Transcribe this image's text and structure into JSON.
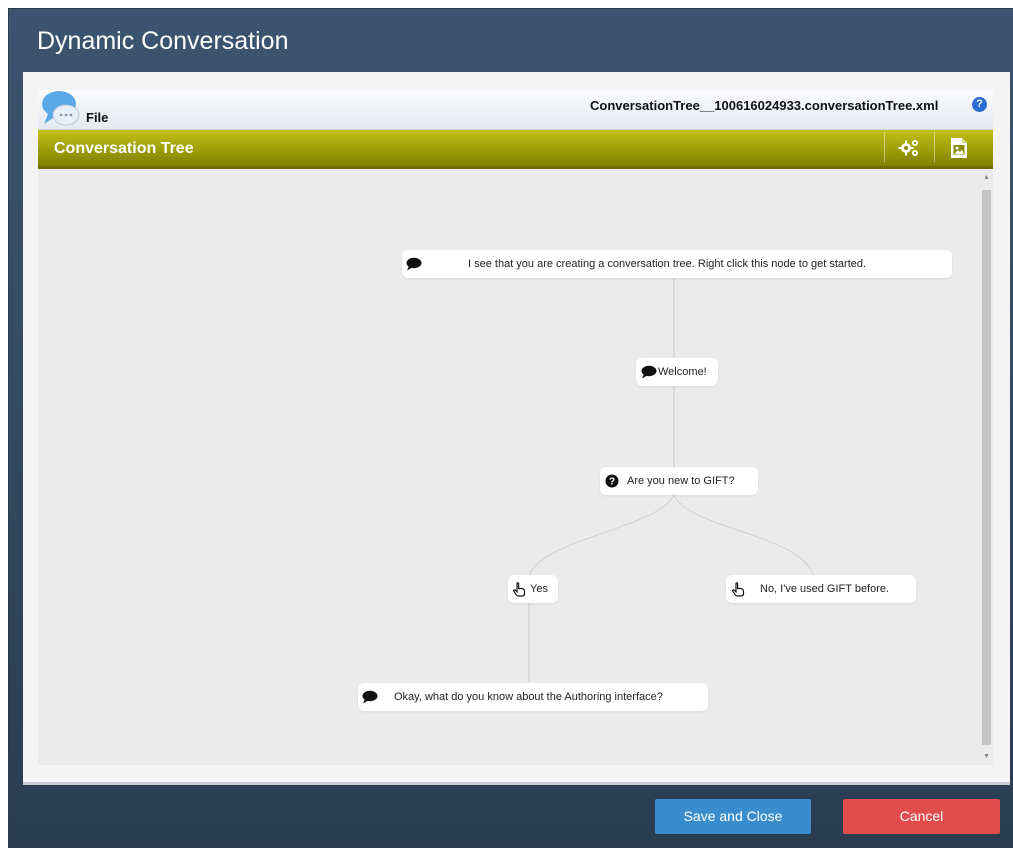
{
  "dialog": {
    "title": "Dynamic Conversation"
  },
  "file_bar": {
    "menu_label": "File",
    "filename": "ConversationTree__100616024933.conversationTree.xml",
    "help_icon": "question-circle-icon"
  },
  "tree_panel": {
    "title": "Conversation Tree",
    "buttons": [
      {
        "icon": "gears-icon"
      },
      {
        "icon": "image-file-icon"
      }
    ]
  },
  "nodes": {
    "intro": {
      "type": "message",
      "icon": "speech-bubble-icon",
      "text": "I see that you are creating a conversation tree. Right click this node to get started."
    },
    "welcome": {
      "type": "message",
      "icon": "speech-bubble-icon",
      "text": "Welcome!"
    },
    "question": {
      "type": "question",
      "icon": "question-circle-icon",
      "text": "Are you new to GIFT?"
    },
    "choice_yes": {
      "type": "choice",
      "icon": "pointing-hand-icon",
      "text": "Yes"
    },
    "choice_no": {
      "type": "choice",
      "icon": "pointing-hand-icon",
      "text": "No, I've used GIFT before."
    },
    "followup": {
      "type": "message",
      "icon": "speech-bubble-icon",
      "text": "Okay, what do you know about the Authoring interface?"
    }
  },
  "footer": {
    "save_label": "Save and Close",
    "cancel_label": "Cancel"
  },
  "colors": {
    "dialog_bg": "#3d5470",
    "tree_header": "#9d9e08",
    "canvas_bg": "#ebebeb",
    "save_button": "#3a8dcc",
    "cancel_button": "#e04c4c",
    "help_icon": "#2c6bd1"
  }
}
